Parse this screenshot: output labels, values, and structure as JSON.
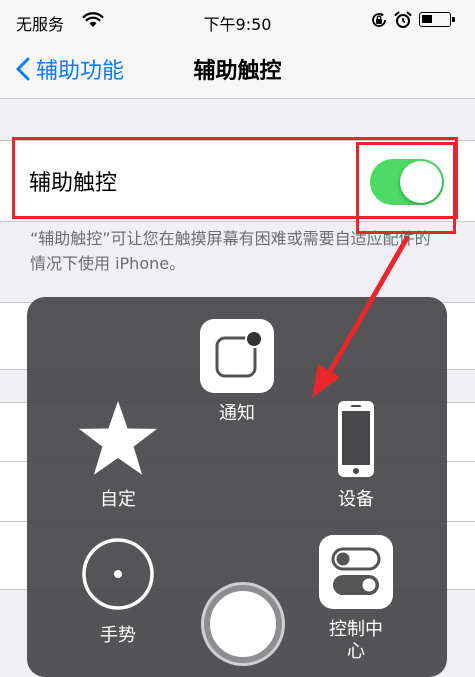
{
  "status_bar": {
    "carrier": "无服务",
    "time": "下午9:50",
    "battery_level": 0.4
  },
  "nav": {
    "back_label": "辅助功能",
    "title": "辅助触控"
  },
  "settings": {
    "assistive_touch_label": "辅助触控",
    "assistive_touch_on": true,
    "footer_note": "“辅助触控”可让您在触摸屏幕有困难或需要自适应配件的情况下使用 iPhone。"
  },
  "menu": {
    "items": {
      "notification": "通知",
      "custom": "自定",
      "device": "设备",
      "gesture": "手势",
      "control_center": "控制中心"
    }
  },
  "annotation_color": "#e8262b",
  "accent_color": "#0a7aff",
  "switch_color": "#4cd964"
}
